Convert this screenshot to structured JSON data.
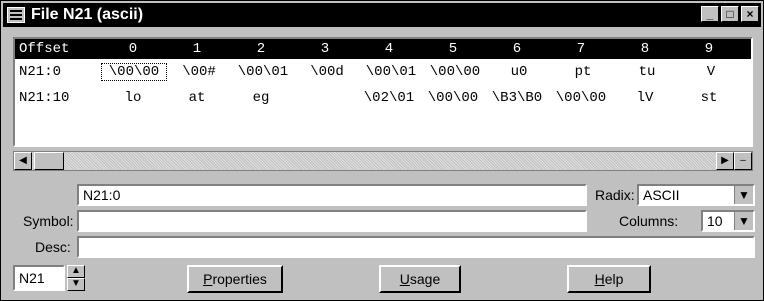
{
  "window": {
    "title": "File N21 (ascii)"
  },
  "titlebar": {
    "minimize": "_",
    "maximize": "□",
    "close": "×"
  },
  "grid": {
    "columns": [
      "Offset",
      "0",
      "1",
      "2",
      "3",
      "4",
      "5",
      "6",
      "7",
      "8",
      "9"
    ],
    "rows": [
      [
        "N21:0",
        "\\00\\00",
        "\\00#",
        "\\00\\01",
        "\\00d",
        "\\00\\01",
        "\\00\\00",
        "u0",
        "pt",
        "tu",
        "V"
      ],
      [
        "N21:10",
        "lo",
        "at",
        "eg",
        "",
        "\\02\\01",
        "\\00\\00",
        "\\B3\\B0",
        "\\00\\00",
        "lV",
        "st"
      ],
      [
        "",
        "",
        "",
        "",
        "",
        "",
        "",
        "",
        "",
        "",
        ""
      ]
    ]
  },
  "scrollbar": {
    "left": "◀",
    "right": "▶",
    "extra": "–"
  },
  "address": {
    "value": "N21:0"
  },
  "symbol": {
    "label": "Symbol:",
    "value": ""
  },
  "desc": {
    "label": "Desc:",
    "value": ""
  },
  "radix": {
    "label": "Radix:",
    "value": "ASCII"
  },
  "columns": {
    "label": "Columns:",
    "value": "10"
  },
  "file": {
    "value": "N21"
  },
  "buttons": {
    "properties_first": "P",
    "properties_rest": "roperties",
    "usage_first": "U",
    "usage_rest": "sage",
    "help_first": "H",
    "help_rest": "elp"
  }
}
